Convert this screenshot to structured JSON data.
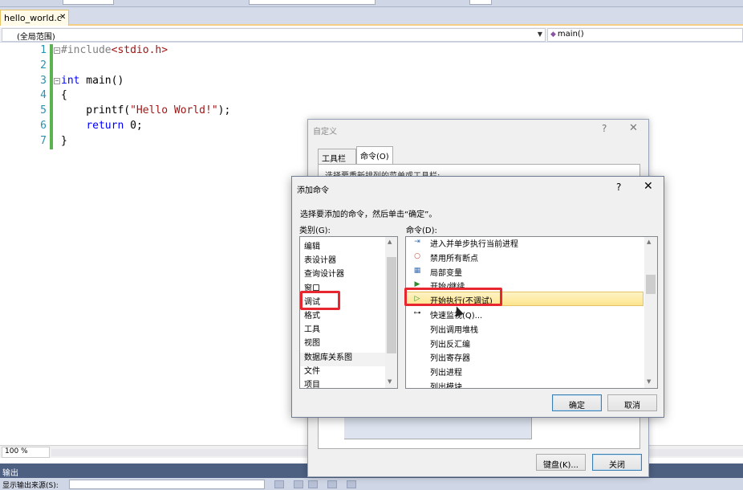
{
  "editor": {
    "tab_label": "hello_world.c",
    "tab_close": "✕",
    "scope": "(全局范围)",
    "member": "main()",
    "lines": [
      {
        "n": "1",
        "parts": [
          {
            "t": "#include",
            "c": "pp"
          },
          {
            "t": "<stdio.h>",
            "c": "inc"
          }
        ]
      },
      {
        "n": "2",
        "parts": []
      },
      {
        "n": "3",
        "parts": [
          {
            "t": "int",
            "c": "kw"
          },
          {
            "t": " main()",
            "c": ""
          }
        ]
      },
      {
        "n": "4",
        "parts": [
          {
            "t": "{",
            "c": ""
          }
        ]
      },
      {
        "n": "5",
        "parts": [
          {
            "t": "    printf(",
            "c": ""
          },
          {
            "t": "\"Hello World!\"",
            "c": "str"
          },
          {
            "t": ");",
            "c": ""
          }
        ]
      },
      {
        "n": "6",
        "parts": [
          {
            "t": "    ",
            "c": ""
          },
          {
            "t": "return",
            "c": "kw"
          },
          {
            "t": " 0;",
            "c": ""
          }
        ]
      },
      {
        "n": "7",
        "parts": [
          {
            "t": "}",
            "c": ""
          }
        ]
      }
    ],
    "zoom": "100 %"
  },
  "output": {
    "title": "输出",
    "source_label": "显示输出来源(S):"
  },
  "customize": {
    "title": "自定义",
    "help": "?",
    "close": "✕",
    "tabs": [
      "工具栏(S)",
      "命令(O)"
    ],
    "panel_text": "选择要重新排列的菜单或工具栏:",
    "keyboard_button": "键盘(K)...",
    "close_button": "关闭"
  },
  "add_command": {
    "title": "添加命令",
    "help": "?",
    "close": "✕",
    "prompt": "选择要添加的命令，然后单击“确定”。",
    "categories_label": "类别(G):",
    "commands_label": "命令(D):",
    "categories": [
      "编辑",
      "表设计器",
      "查询设计器",
      "窗口",
      "调试",
      "格式",
      "工具",
      "视图",
      "数据库关系图",
      "文件",
      "项目"
    ],
    "selected_category": "调试",
    "commands": [
      {
        "label": "进入并单步执行当前进程",
        "icon": "step-into-process-icon",
        "glyph": "⇥",
        "color": "#3b6fb6"
      },
      {
        "label": "禁用所有断点",
        "icon": "disable-breakpoints-icon",
        "glyph": "○",
        "color": "#c0392b"
      },
      {
        "label": "局部变量",
        "icon": "locals-window-icon",
        "glyph": "▦",
        "color": "#3b6fb6"
      },
      {
        "label": "开始/继续",
        "icon": "start-continue-icon",
        "glyph": "▶",
        "color": "#2e8b2e"
      },
      {
        "label": "开始执行(不调试)",
        "icon": "start-without-debugging-icon",
        "glyph": "▷",
        "color": "#2e8b2e"
      },
      {
        "label": "快速监视(Q)...",
        "icon": "quick-watch-icon",
        "glyph": "⊶",
        "color": "#333333"
      },
      {
        "label": "列出调用堆栈",
        "icon": "",
        "glyph": "",
        "color": "#000000"
      },
      {
        "label": "列出反汇编",
        "icon": "",
        "glyph": "",
        "color": "#000000"
      },
      {
        "label": "列出寄存器",
        "icon": "",
        "glyph": "",
        "color": "#000000"
      },
      {
        "label": "列出进程",
        "icon": "",
        "glyph": "",
        "color": "#000000"
      },
      {
        "label": "列出模块",
        "icon": "",
        "glyph": "",
        "color": "#000000"
      }
    ],
    "selected_command": "开始执行(不调试)",
    "ok_button": "确定",
    "cancel_button": "取消"
  },
  "colors": {
    "highlight": "#e8262f",
    "selection": "#fde58d",
    "line_numbers": "#2b91af",
    "keyword": "#0000ff"
  }
}
